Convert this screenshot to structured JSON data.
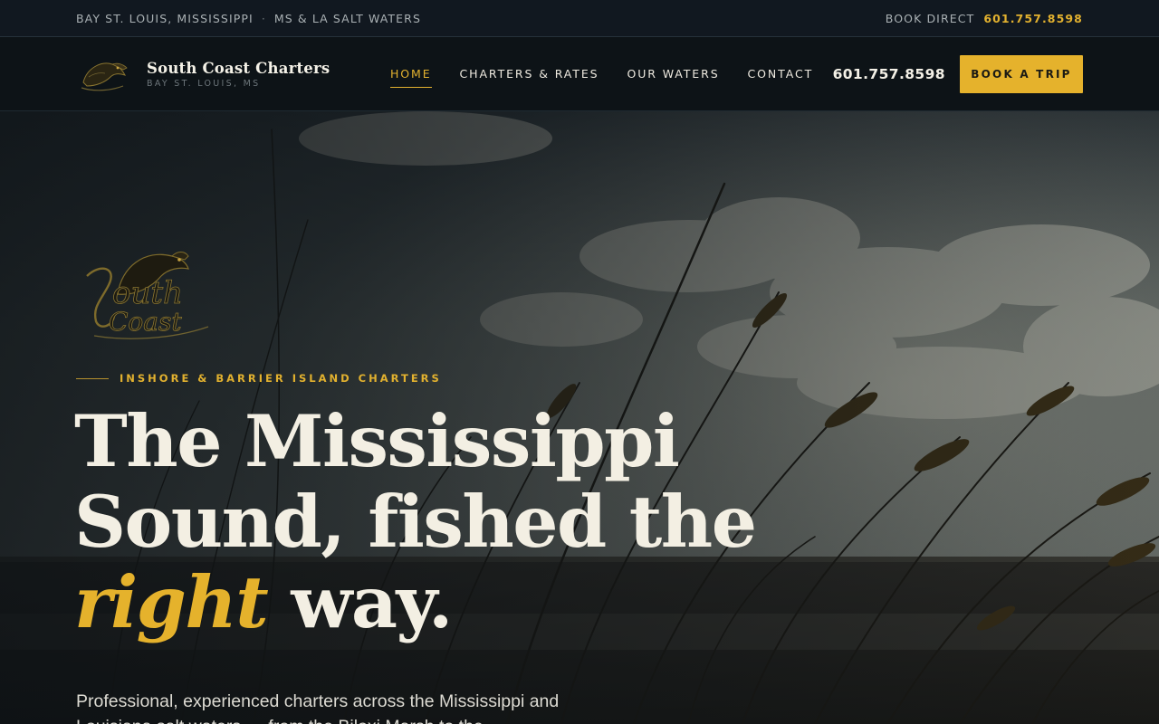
{
  "topbar": {
    "location": "BAY ST. LOUIS, MISSISSIPPI",
    "separator": "·",
    "waters": "MS & LA SALT WATERS",
    "book_label": "BOOK DIRECT",
    "phone": "601.757.8598"
  },
  "brand": {
    "name": "South Coast Charters",
    "location": "BAY ST. LOUIS, MS",
    "logo_icon": "fish-logo-icon"
  },
  "nav": {
    "items": [
      {
        "label": "HOME",
        "active": true
      },
      {
        "label": "CHARTERS & RATES",
        "active": false
      },
      {
        "label": "OUR WATERS",
        "active": false
      },
      {
        "label": "CONTACT",
        "active": false
      }
    ],
    "phone": "601.757.8598",
    "cta": "BOOK A TRIP"
  },
  "hero": {
    "eyebrow": "INSHORE & BARRIER ISLAND CHARTERS",
    "headline_line1": "The Mississippi",
    "headline_line2": "Sound, fished the",
    "headline_accent": "right",
    "headline_end": " way.",
    "lede": "Professional, experienced charters across the Mississippi and Louisiana salt waters — from the Biloxi Marsh to the",
    "background": "sea-oats-over-water-at-dusk"
  },
  "colors": {
    "accent": "#e5b22c",
    "topbar_bg": "#111820",
    "nav_bg": "#0d1317",
    "text_light": "#f3efe3"
  }
}
